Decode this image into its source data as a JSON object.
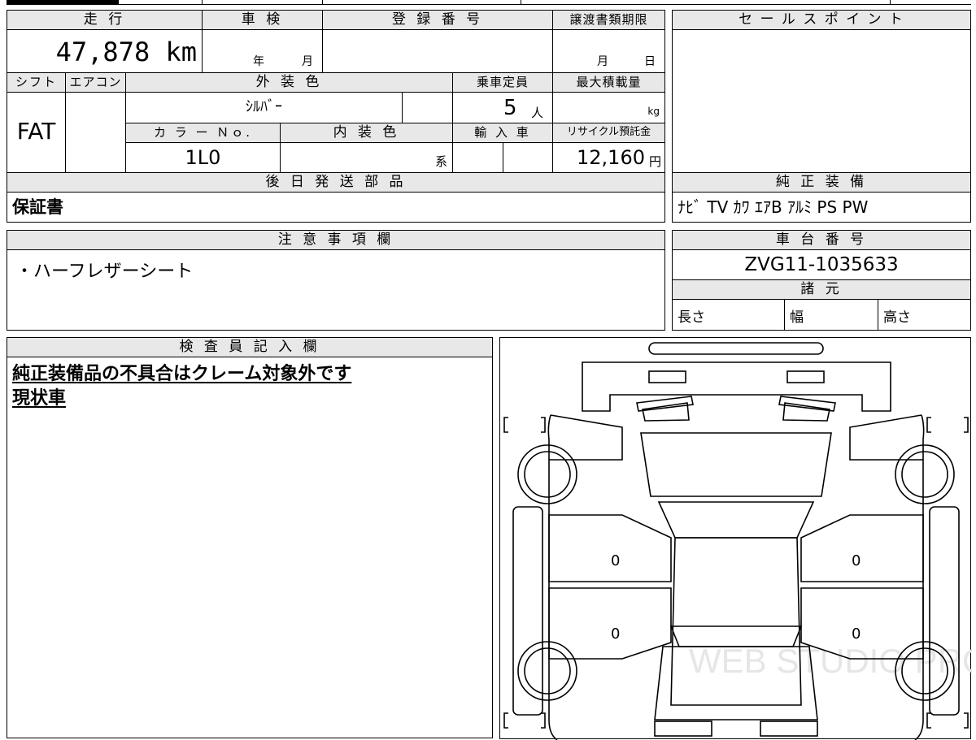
{
  "header": {
    "mileage_label": "走 行",
    "inspection_label": "車 検",
    "registration_label": "登 録 番 号",
    "transfer_doc_label": "譲渡書類期限",
    "sales_point_label": "セ ー ル ス ポ イ ン ト"
  },
  "mileage": "47,878 km",
  "inspection": {
    "year": "年",
    "month": "月"
  },
  "registration_number": "",
  "transfer_deadline": {
    "month": "月",
    "day": "日"
  },
  "row2_labels": {
    "shift": "シフト",
    "aircon": "エアコン",
    "exterior": "外 装 色",
    "capacity": "乗車定員",
    "max_load": "最大積載量"
  },
  "shift": "FAT",
  "exterior_color": "ｼﾙﾊﾞｰ",
  "capacity": {
    "value": "5",
    "unit": "人"
  },
  "max_load_unit": "kg",
  "row3_labels": {
    "color_no": "カ ラ ー Ｎｏ.",
    "interior": "内 装 色",
    "import": "輸 入 車",
    "recycle": "リサイクル預託金"
  },
  "color_no": "1L0",
  "interior_suffix": "系",
  "recycle_fee": {
    "value": "12,160",
    "unit": "円"
  },
  "parts_label": "後 日 発 送 部 品",
  "parts_value": "保証書",
  "genuine_label": "純 正 装 備",
  "genuine_value": "ﾅﾋﾞ TV ｶﾜ ｴｱB ｱﾙﾐ PS PW",
  "notes_label": "注 意 事 項 欄",
  "notes_value": "・ハーフレザーシート",
  "chassis_label": "車 台 番 号",
  "chassis_number": "ZVG11-1035633",
  "specs_label": "諸 元",
  "specs": {
    "length": "長さ",
    "width": "幅",
    "height": "高さ"
  },
  "inspector_label": "検 査 員 記 入 欄",
  "inspector_lines": [
    "純正装備品の不具合はクレーム対象外です",
    "現状車"
  ],
  "diagram_marks": [
    "0",
    "0",
    "0",
    "0"
  ],
  "watermark": "WEB STUDIO PRO"
}
